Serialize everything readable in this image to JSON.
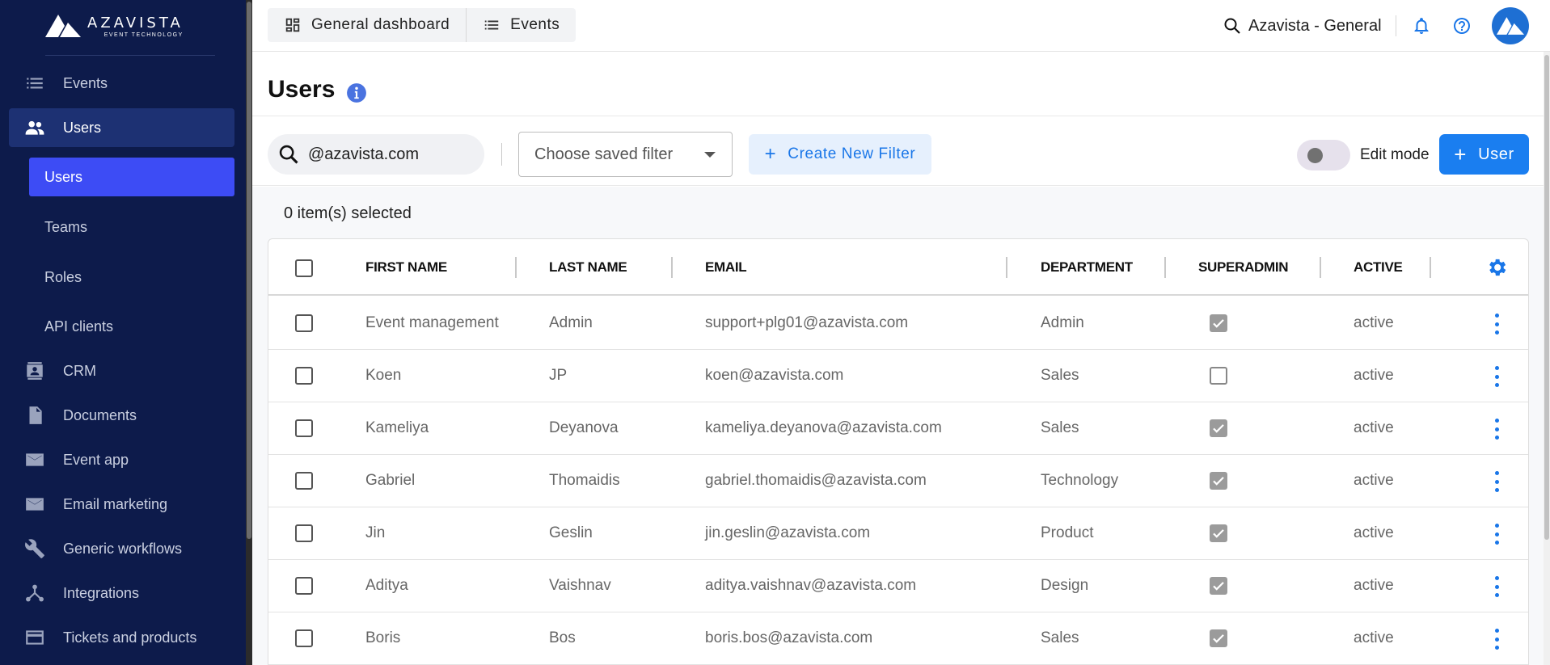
{
  "brand": {
    "name": "AZAVISTA",
    "tagline": "EVENT TECHNOLOGY"
  },
  "sidebar": {
    "items": [
      {
        "id": "events",
        "label": "Events",
        "icon": "list-icon"
      },
      {
        "id": "users",
        "label": "Users",
        "icon": "people-icon",
        "active": true
      },
      {
        "id": "crm",
        "label": "CRM",
        "icon": "contact-card-icon"
      },
      {
        "id": "documents",
        "label": "Documents",
        "icon": "document-icon"
      },
      {
        "id": "event-app",
        "label": "Event app",
        "icon": "mail-icon"
      },
      {
        "id": "email-marketing",
        "label": "Email marketing",
        "icon": "mail-icon"
      },
      {
        "id": "generic-workflows",
        "label": "Generic workflows",
        "icon": "wrench-icon"
      },
      {
        "id": "integrations",
        "label": "Integrations",
        "icon": "hub-icon"
      },
      {
        "id": "tickets",
        "label": "Tickets and products",
        "icon": "card-icon"
      }
    ],
    "subitems": [
      {
        "label": "Users",
        "active": true
      },
      {
        "label": "Teams"
      },
      {
        "label": "Roles"
      },
      {
        "label": "API clients"
      }
    ]
  },
  "topbar": {
    "tabs": [
      {
        "label": "General dashboard",
        "icon": "dashboard-icon"
      },
      {
        "label": "Events",
        "icon": "list-icon"
      }
    ],
    "search_text": "Azavista - General",
    "accent": "#1976e8"
  },
  "page": {
    "title": "Users"
  },
  "toolbar": {
    "search_value": "@azavista.com",
    "saved_filter_placeholder": "Choose saved filter",
    "create_filter_label": "Create New Filter",
    "edit_mode_label": "Edit mode",
    "add_user_label": "User"
  },
  "selection": {
    "text": "0 item(s) selected"
  },
  "table": {
    "columns": [
      "FIRST NAME",
      "LAST NAME",
      "EMAIL",
      "DEPARTMENT",
      "SUPERADMIN",
      "ACTIVE"
    ],
    "rows": [
      {
        "first": "Event management",
        "last": "Admin",
        "email": "support+plg01@azavista.com",
        "dept": "Admin",
        "superadmin": true,
        "active": "active"
      },
      {
        "first": "Koen",
        "last": "JP",
        "email": "koen@azavista.com",
        "dept": "Sales",
        "superadmin": false,
        "active": "active"
      },
      {
        "first": "Kameliya",
        "last": "Deyanova",
        "email": "kameliya.deyanova@azavista.com",
        "dept": "Sales",
        "superadmin": true,
        "active": "active"
      },
      {
        "first": "Gabriel",
        "last": "Thomaidis",
        "email": "gabriel.thomaidis@azavista.com",
        "dept": "Technology",
        "superadmin": true,
        "active": "active"
      },
      {
        "first": "Jin",
        "last": "Geslin",
        "email": "jin.geslin@azavista.com",
        "dept": "Product",
        "superadmin": true,
        "active": "active"
      },
      {
        "first": "Aditya",
        "last": "Vaishnav",
        "email": "aditya.vaishnav@azavista.com",
        "dept": "Design",
        "superadmin": true,
        "active": "active"
      },
      {
        "first": "Boris",
        "last": "Bos",
        "email": "boris.bos@azavista.com",
        "dept": "Sales",
        "superadmin": true,
        "active": "active"
      }
    ]
  }
}
